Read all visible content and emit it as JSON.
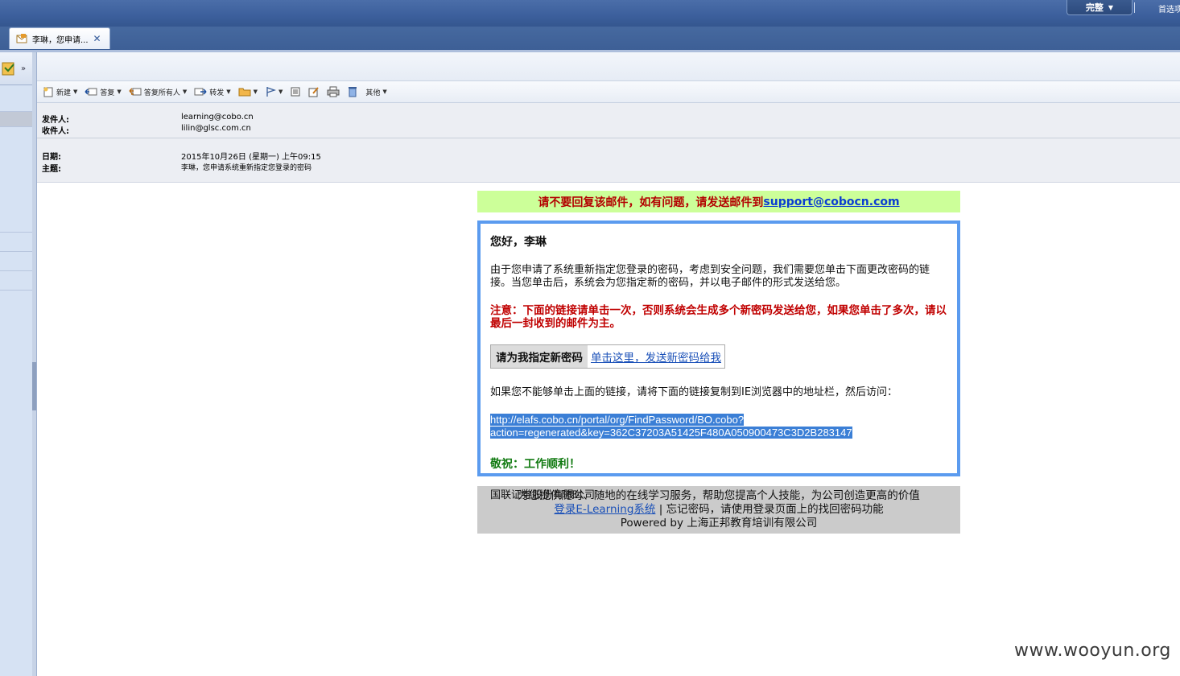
{
  "topbar": {
    "view_select": "完整",
    "prefs_link": "首选项"
  },
  "tab": {
    "title": "李琳，您申请...",
    "close_icon": "close-icon"
  },
  "toolbar": {
    "new": "新建",
    "reply": "答复",
    "reply_all": "答复所有人",
    "forward": "转发",
    "other": "其他"
  },
  "headers": {
    "from_label": "发件人:",
    "from_value": "learning@cobo.cn",
    "to_label": "收件人:",
    "to_value": "lilin@glsc.com.cn",
    "date_label": "日期:",
    "date_value": "2015年10月26日 (星期一) 上午09:15",
    "subject_label": "主题:",
    "subject_value": "李琳，您申请系统重新指定您登录的密码"
  },
  "email": {
    "notice_text": "请不要回复该邮件，如有问题，请发送邮件到",
    "notice_link": "support@cobocn.com",
    "greeting": "您好，李琳",
    "intro": "由于您申请了系统重新指定您登录的密码，考虑到安全问题，我们需要您单击下面更改密码的链接。当您单击后，系统会为您指定新的密码，并以电子邮件的形式发送给您。",
    "warning": "注意：下面的链接请单击一次，否则系统会生成多个新密码发送给您，如果您单击了多次，请以最后一封收到的邮件为主。",
    "action_label": "请为我指定新密码",
    "action_link": "单击这里，发送新密码给我",
    "fallback": "如果您不能够单击上面的链接，请将下面的链接复制到IE浏览器中的地址栏，然后访问：",
    "url_line1": "http://elafs.cobo.cn/portal/org/FindPassword/BO.cobo?",
    "url_line2": "action=regenerated&key=362C37203A51425F480A050900473C3D2B283147",
    "regards": "敬祝：工作顺利！",
    "signature": "国联证券股份有限公司"
  },
  "footer": {
    "line1": "为您提供随时、随地的在线学习服务，帮助您提高个人技能，为公司创造更高的价值",
    "login_link": "登录E-Learning系统",
    "line2_rest": " | 忘记密码，请使用登录页面上的找回密码功能",
    "line3": "Powered by 上海正邦教育培训有限公司"
  },
  "watermark": "www.wooyun.org"
}
